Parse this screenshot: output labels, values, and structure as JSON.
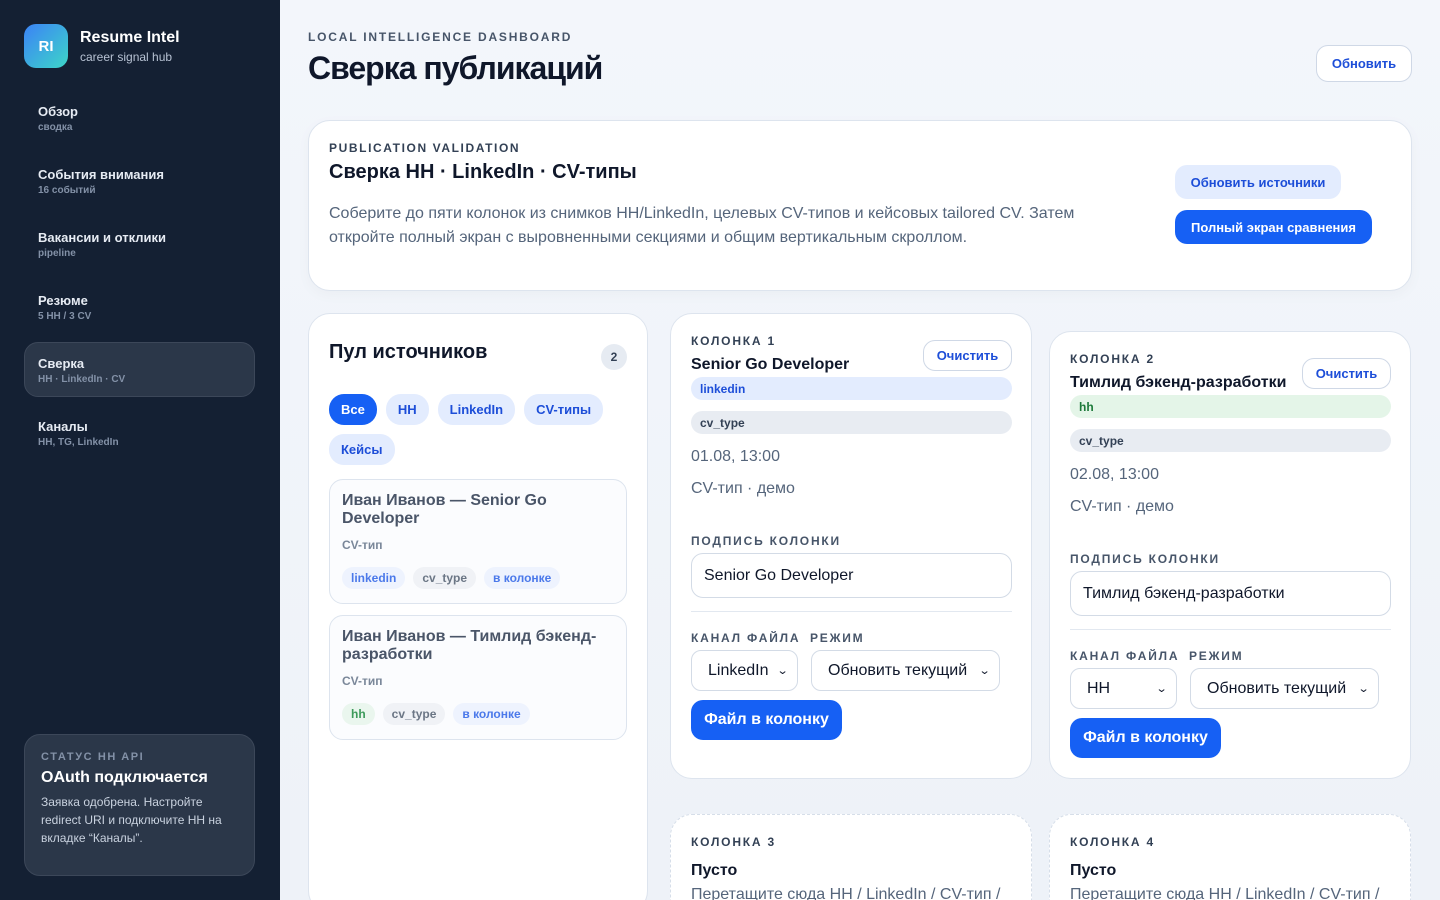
{
  "brand": {
    "logo": "RI",
    "title": "Resume Intel",
    "subtitle": "career signal hub"
  },
  "nav": [
    {
      "label": "Обзор",
      "sub": "сводка"
    },
    {
      "label": "События внимания",
      "sub": "16 событий"
    },
    {
      "label": "Вакансии и отклики",
      "sub": "pipeline"
    },
    {
      "label": "Резюме",
      "sub": "5 HH / 3 CV"
    },
    {
      "label": "Сверка",
      "sub": "HH · LinkedIn · CV",
      "active": true
    },
    {
      "label": "Каналы",
      "sub": "HH, TG, LinkedIn"
    }
  ],
  "api_status": {
    "kicker": "СТАТУС HH API",
    "title": "OAuth подключается",
    "text": "Заявка одобрена. Настройте redirect URI и подключите HH на вкладке “Каналы”."
  },
  "header": {
    "kicker": "LOCAL INTELLIGENCE DASHBOARD",
    "title": "Сверка публикаций",
    "refresh": "Обновить"
  },
  "hero": {
    "kicker": "PUBLICATION VALIDATION",
    "title": "Сверка HH · LinkedIn · CV-типы",
    "description": "Соберите до пяти колонок из снимков HH/LinkedIn, целевых CV-типов и кейсовых tailored CV. Затем откройте полный экран с выровненными секциями и общим вертикальным скроллом.",
    "refresh_sources": "Обновить источники",
    "fullscreen": "Полный экран сравнения"
  },
  "pool": {
    "title": "Пул источников",
    "count": "2",
    "filters": [
      "Все",
      "HH",
      "LinkedIn",
      "CV-типы",
      "Кейсы"
    ],
    "items": [
      {
        "title": "Иван Иванов — Senior Go Developer",
        "sub": "CV-тип",
        "tags": [
          "linkedin",
          "cv_type",
          "в колонке"
        ]
      },
      {
        "title": "Иван Иванов — Тимлид бэкенд-разработки",
        "sub": "CV-тип",
        "tags": [
          "hh",
          "cv_type",
          "в колонке"
        ]
      }
    ]
  },
  "columns": [
    {
      "kicker": "КОЛОНКА 1",
      "title": "Senior Go Developer",
      "clear": "Очистить",
      "channel_tag": "linkedin",
      "type_tag": "cv_type",
      "date": "01.08, 13:00",
      "meta": "CV-тип · демо",
      "caption_label": "ПОДПИСЬ КОЛОНКИ",
      "caption_value": "Senior Go Developer",
      "channel_label": "КАНАЛ ФАЙЛА",
      "mode_label": "РЕЖИМ",
      "channel_value": "LinkedIn",
      "mode_value": "Обновить текущий",
      "action": "Файл в колонку"
    },
    {
      "kicker": "КОЛОНКА 2",
      "title": "Тимлид бэкенд-разработки",
      "clear": "Очистить",
      "channel_tag": "hh",
      "type_tag": "cv_type",
      "date": "02.08, 13:00",
      "meta": "CV-тип · демо",
      "caption_label": "ПОДПИСЬ КОЛОНКИ",
      "caption_value": "Тимлид бэкенд-разработки",
      "channel_label": "КАНАЛ ФАЙЛА",
      "mode_label": "РЕЖИМ",
      "channel_value": "HH",
      "mode_value": "Обновить текущий",
      "action": "Файл в колонку"
    }
  ],
  "empty_columns": [
    {
      "kicker": "КОЛОНКА 3",
      "title": "Пусто",
      "text": "Перетащите сюда HH / LinkedIn / CV-тип /"
    },
    {
      "kicker": "КОЛОНКА 4",
      "title": "Пусто",
      "text": "Перетащите сюда HH / LinkedIn / CV-тип /"
    }
  ]
}
